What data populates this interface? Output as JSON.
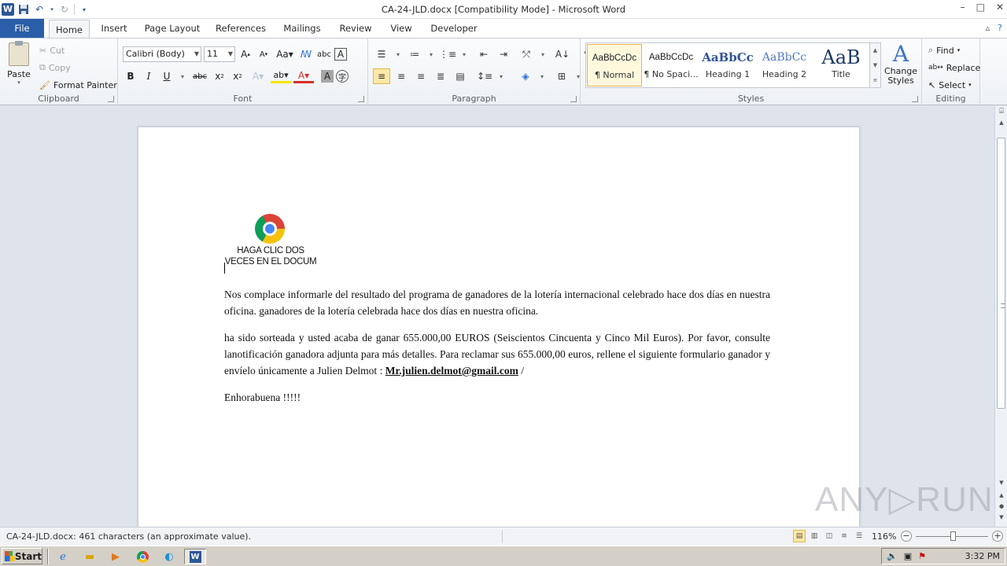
{
  "window": {
    "title": "CA-24-JLD.docx [Compatibility Mode] - Microsoft Word",
    "app_icon_letter": "W",
    "controls": [
      "–",
      "□",
      "✕"
    ]
  },
  "tabs": {
    "file": "File",
    "home": "Home",
    "insert": "Insert",
    "page_layout": "Page Layout",
    "references": "References",
    "mailings": "Mailings",
    "review": "Review",
    "view": "View",
    "developer": "Developer"
  },
  "clipboard": {
    "paste": "Paste",
    "cut": "Cut",
    "copy": "Copy",
    "format_painter": "Format Painter",
    "label": "Clipboard"
  },
  "font": {
    "family": "Calibri (Body)",
    "size": "11",
    "label": "Font",
    "bold": "B",
    "italic": "I",
    "underline": "U",
    "strike": "abc",
    "font_color": "#d3302a",
    "highlight_color": "#f5e400"
  },
  "paragraph": {
    "label": "Paragraph",
    "pilcrow": "¶"
  },
  "styles": {
    "label": "Styles",
    "items": [
      {
        "sample": "AaBbCcDc",
        "name": "¶ Normal"
      },
      {
        "sample": "AaBbCcDc",
        "name": "¶ No Spaci..."
      },
      {
        "sample": "AaBbCc",
        "name": "Heading 1"
      },
      {
        "sample": "AaBbCc",
        "name": "Heading 2"
      },
      {
        "sample": "AaB",
        "name": "Title"
      }
    ],
    "change_styles": "Change Styles",
    "change_styles_glyph": "A"
  },
  "editing": {
    "label": "Editing",
    "find": "Find",
    "replace": "Replace",
    "select": "Select"
  },
  "document": {
    "embed_caption": "HAGA CLIC DOS VECES EN EL DOCUM",
    "paragraph1": "Nos complace informarle del resultado del programa de ganadores de la lotería internacional celebrado hace dos días en nuestra oficina. ganadores de la lotería celebrada hace dos días en nuestra oficina.",
    "paragraph2_before": "ha sido sorteada y usted acaba de ganar 655.000,00 EUROS (Seiscientos Cincuenta y Cinco Mil Euros). Por favor, consulte lanotificación ganadora adjunta para más detalles. Para reclamar sus 655.000,00 euros, rellene el siguiente formulario ganador y envíelo únicamente a Julien Delmot : ",
    "email": "Mr.julien.delmot@gmail.com",
    "paragraph2_after": " /",
    "paragraph3": "Enhorabuena !!!!!"
  },
  "status": {
    "text": "CA-24-JLD.docx: 461 characters (an approximate value).",
    "zoom": "116%",
    "zoom_level_percent": 116
  },
  "watermark": "ANY▷RUN",
  "taskbar": {
    "start": "Start",
    "time": "3:32 PM"
  }
}
